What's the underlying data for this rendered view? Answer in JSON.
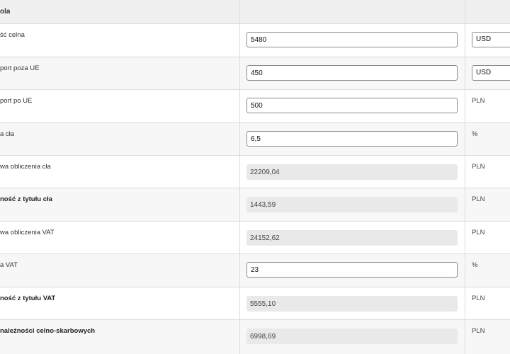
{
  "header": {
    "title": "ola"
  },
  "rows": [
    {
      "label": "ść celna",
      "value": "5480",
      "unit": "USD"
    },
    {
      "label": "port poza UE",
      "value": "450",
      "unit": "USD"
    },
    {
      "label": "port po UE",
      "value": "500",
      "unit": "PLN"
    },
    {
      "label": "a cła",
      "value": "6,5",
      "unit": "%"
    },
    {
      "label": "wa obliczenia cła",
      "value": "22209,04",
      "unit": "PLN"
    },
    {
      "label": "ność z tytułu cła",
      "value": "1443,59",
      "unit": "PLN"
    },
    {
      "label": "wa obliczenia VAT",
      "value": "24152,62",
      "unit": "PLN"
    },
    {
      "label": "a VAT",
      "value": "23",
      "unit": "%"
    },
    {
      "label": "ność z tytułu VAT",
      "value": "5555,10",
      "unit": "PLN"
    },
    {
      "label": "należności celno-skarbowych",
      "value": "6998,69",
      "unit": "PLN"
    }
  ]
}
